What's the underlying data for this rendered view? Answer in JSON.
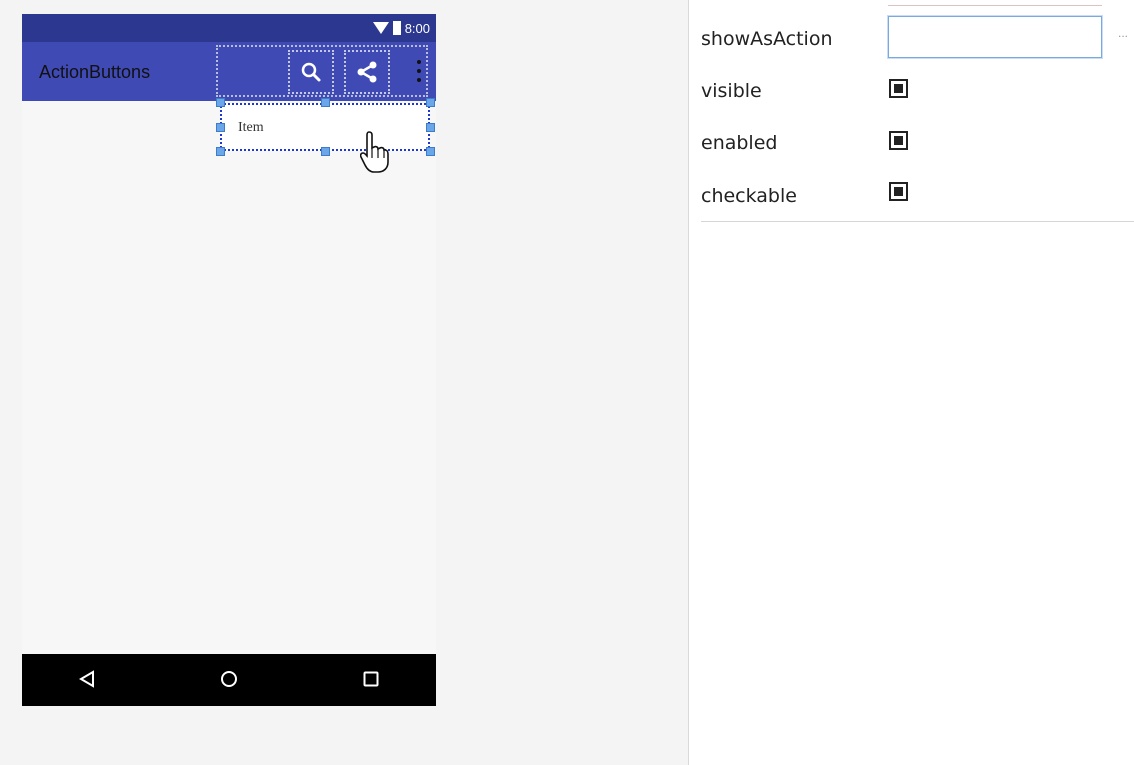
{
  "phone": {
    "status_time": "8:00",
    "app_title": "ActionButtons",
    "actions": {
      "search": "search-icon",
      "share": "share-icon",
      "overflow": "overflow-menu-icon"
    },
    "menu_item_label": "Item",
    "colors": {
      "status_bar": "#2c3790",
      "toolbar": "#3f4ab5",
      "selection": "#1c38d0",
      "nav_bar": "#000000"
    }
  },
  "properties": {
    "rows": [
      {
        "label": "showAsAction",
        "type": "text",
        "value": ""
      },
      {
        "label": "visible",
        "type": "checkbox",
        "checked": true
      },
      {
        "label": "enabled",
        "type": "checkbox",
        "checked": true
      },
      {
        "label": "checkable",
        "type": "checkbox",
        "checked": true
      }
    ],
    "ellipsis": "..."
  }
}
